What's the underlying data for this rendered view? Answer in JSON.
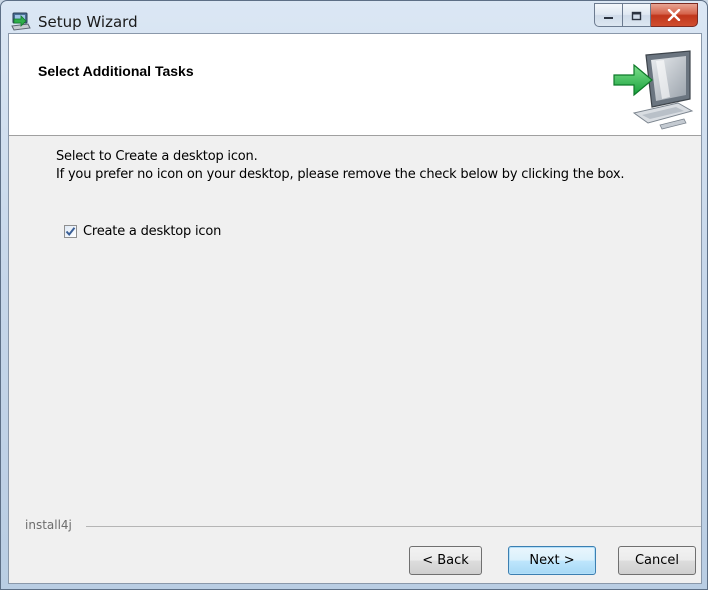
{
  "window": {
    "title": "Setup Wizard",
    "icon": "setup-wizard-computer-icon",
    "controls": {
      "minimize": "minimize-icon",
      "maximize": "maximize-icon",
      "close": "close-icon"
    }
  },
  "header": {
    "title": "Select Additional Tasks",
    "graphic": "computer-with-green-arrow-icon"
  },
  "body": {
    "line1": "Select to Create a desktop icon.",
    "line2": "If you prefer no icon on your desktop, please remove the check below by clicking the box.",
    "checkbox": {
      "label": "Create a desktop icon",
      "checked": true
    }
  },
  "footer": {
    "brand": "install4j",
    "back_label": "< Back",
    "next_label": "Next >",
    "cancel_label": "Cancel"
  },
  "colors": {
    "close_button": "#c0361b",
    "default_button_border": "#3c7fb1",
    "arrow_green": "#22b24c"
  }
}
